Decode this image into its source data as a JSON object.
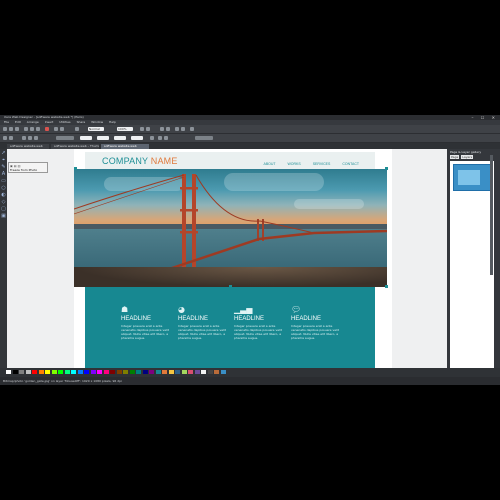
{
  "app": {
    "title": "Xara Web Designer - [software website.web *] (Paris)",
    "menu": [
      "File",
      "Edit",
      "Arrange",
      "Insert",
      "Utilities",
      "Share",
      "Window",
      "Help"
    ],
    "toolbar_values": {
      "zoom": "Normal",
      "size": "100%"
    },
    "document_tabs": [
      "software website.web",
      "software website.web – Thumbnail",
      "software website.web"
    ],
    "active_tab": 2,
    "tooltip": "Freeze from Photo"
  },
  "website": {
    "logo_part1": "COMPANY",
    "logo_part2": "NAME",
    "nav": [
      "ABOUT",
      "WORKS",
      "SERVICES",
      "CONTACT"
    ],
    "brand_colors": {
      "teal": "#178891",
      "orange": "#e0793b"
    },
    "features": [
      {
        "icon": "team-icon",
        "headline": "HEADLINE",
        "text": "Integer posuere erat a ante venenatis dapibus posuere velit aliquet. Nulla vitae elit libero, a pharetra augue."
      },
      {
        "icon": "pie-chart-icon",
        "headline": "HEADLINE",
        "text": "Integer posuere erat a ante venenatis dapibus posuere velit aliquet. Nulla vitae elit libero, a pharetra augue."
      },
      {
        "icon": "bar-chart-icon",
        "headline": "HEADLINE",
        "text": "Integer posuere erat a ante venenatis dapibus posuere velit aliquet. Nulla vitae elit libero, a pharetra augue."
      },
      {
        "icon": "speech-bubble-icon",
        "headline": "HEADLINE",
        "text": "Integer posuere erat a ante venenatis dapibus posuere velit aliquet. Nulla vitae elit libero, a pharetra augue."
      }
    ]
  },
  "right_panel": {
    "title": "Page & Layer gallery",
    "tabs": [
      "Page",
      "Layers"
    ]
  },
  "status": {
    "text": "Bitmap/photo 'golden_gate.jpg' on layer 'MouseOff': 1920 x 1080 pixels, 96 dpi"
  },
  "palette_colors": [
    "#ffffff",
    "#000000",
    "#808080",
    "#c0c0c0",
    "#ff0000",
    "#ff8000",
    "#ffff00",
    "#80ff00",
    "#00ff00",
    "#00ff80",
    "#00ffff",
    "#0080ff",
    "#0000ff",
    "#8000ff",
    "#ff00ff",
    "#ff0080",
    "#7f0000",
    "#7f3f00",
    "#7f7f00",
    "#007f00",
    "#007f7f",
    "#00007f",
    "#7f007f",
    "#178891",
    "#e0793b",
    "#f4c542",
    "#2c5f8a",
    "#a4d65e",
    "#d94f70",
    "#6b4c9a",
    "#f2f2f2",
    "#444444",
    "#b86b3a",
    "#3a8fc6"
  ]
}
